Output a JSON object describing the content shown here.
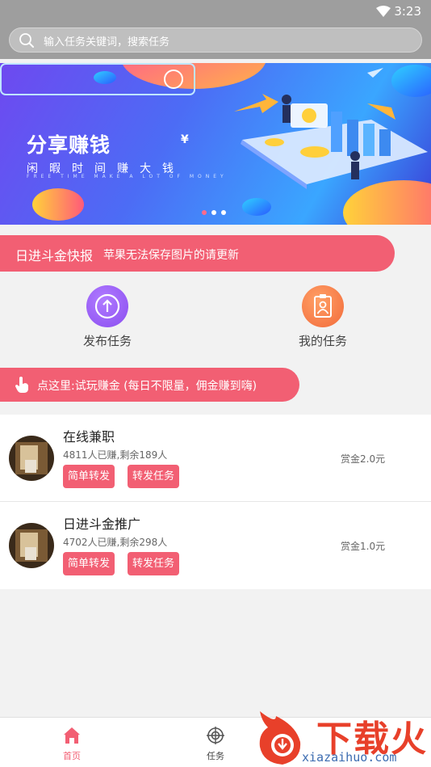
{
  "status_bar": {
    "time": "3:23"
  },
  "search": {
    "placeholder": "输入任务关键词，搜索任务"
  },
  "banner": {
    "title": "分享赚钱",
    "currency_symbol": "¥",
    "subtitle": "闲暇时间赚大钱",
    "subtitle_en": "FREE TIME MAKE A LOT OF MONEY",
    "slide_count": 3,
    "active_slide": 1
  },
  "news": {
    "title": "日进斗金快报",
    "text": "苹果无法保存图片的请更新"
  },
  "actions": [
    {
      "label": "发布任务",
      "icon": "upload-icon"
    },
    {
      "label": "我的任务",
      "icon": "clipboard-user-icon"
    }
  ],
  "try_bar": {
    "text": "点这里:试玩赚金 (每日不限量，佣金赚到嗨)",
    "icon": "hand-pointer-icon"
  },
  "tasks": [
    {
      "name": "在线兼职",
      "stat": "4811人已赚,剩余189人",
      "tag1": "简单转发",
      "tag2": "转发任务",
      "reward": "赏金2.0元"
    },
    {
      "name": "日进斗金推广",
      "stat": "4702人已赚,剩余298人",
      "tag1": "简单转发",
      "tag2": "转发任务",
      "reward": "赏金1.0元"
    }
  ],
  "tabs": [
    {
      "label": "首页",
      "icon": "home-icon",
      "active": true
    },
    {
      "label": "任务",
      "icon": "target-icon",
      "active": false
    }
  ],
  "watermark": {
    "logo_text": "下载火",
    "url": "xiazaihuo.com"
  },
  "colors": {
    "accent": "#f25f73",
    "header_gray": "#9e9e9e",
    "publish_purple": "#8a4df0",
    "mytask_orange": "#f26a3a"
  }
}
